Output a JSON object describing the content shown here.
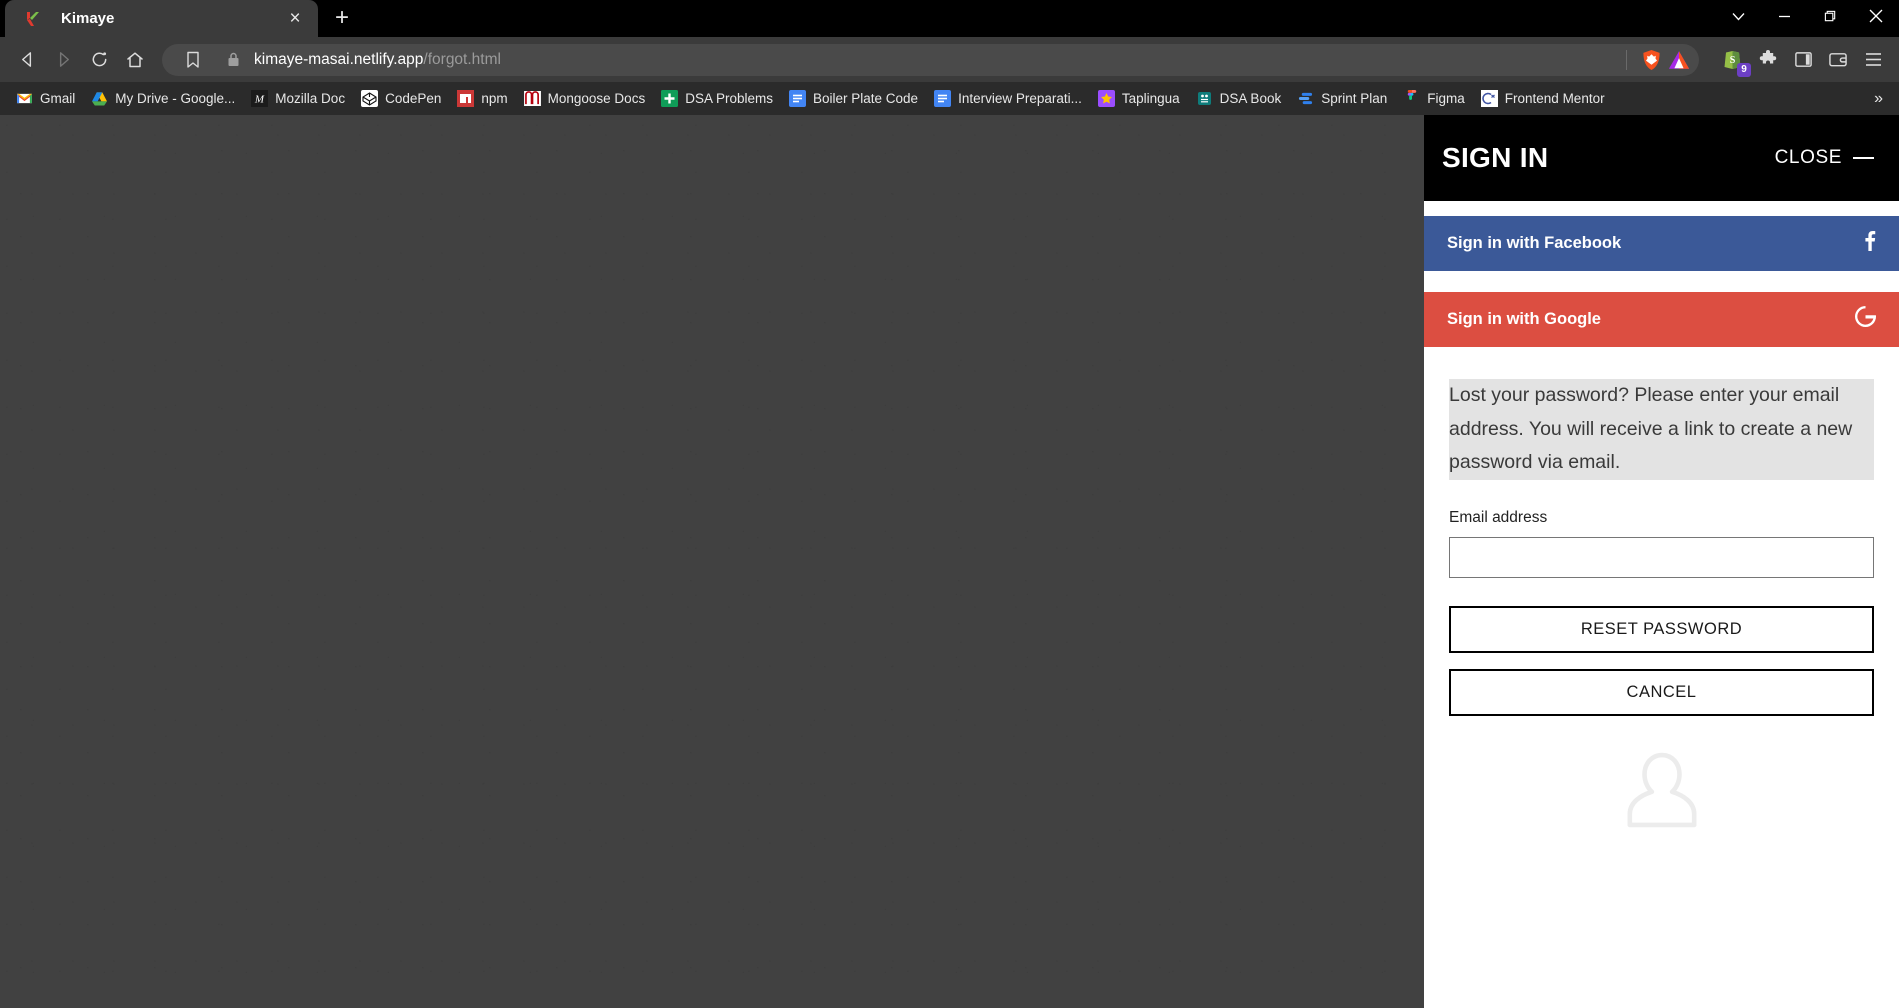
{
  "browser": {
    "tab": {
      "title": "Kimaye",
      "favicon": "kimaye-k-logo",
      "close_label": "×"
    },
    "new_tab_label": "+",
    "window_controls": [
      {
        "name": "tab-search",
        "glyph": "⌄"
      },
      {
        "name": "minimize",
        "glyph": "—"
      },
      {
        "name": "maximize",
        "glyph": "□"
      },
      {
        "name": "close",
        "glyph": "✕"
      }
    ],
    "nav": {
      "back_label": "◁",
      "forward_label": "▷",
      "reload_label": "↻",
      "home_label": "⌂",
      "bookmark_label": "☐"
    },
    "address": {
      "lock_icon": "lock-icon",
      "url_domain": "kimaye-masai.netlify.app",
      "url_path": "/forgot.html",
      "shield_icon": "brave-shield-icon",
      "rewards_icon": "brave-rewards-triangle-icon"
    },
    "toolbar_icons": [
      {
        "name": "shopify-extension-icon",
        "badge": "9"
      },
      {
        "name": "extensions-puzzle-icon",
        "badge": ""
      },
      {
        "name": "sidebar-panel-icon",
        "badge": ""
      },
      {
        "name": "wallet-icon",
        "badge": ""
      },
      {
        "name": "browser-menu-icon",
        "badge": ""
      }
    ],
    "bookmarks": {
      "items": [
        {
          "label": "Gmail",
          "icon": "gmail-icon"
        },
        {
          "label": "My Drive - Google...",
          "icon": "google-drive-icon"
        },
        {
          "label": "Mozilla Doc",
          "icon": "mdn-icon"
        },
        {
          "label": "CodePen",
          "icon": "codepen-icon"
        },
        {
          "label": "npm",
          "icon": "npm-icon"
        },
        {
          "label": "Mongoose Docs",
          "icon": "mongoose-icon"
        },
        {
          "label": "DSA Problems",
          "icon": "sheets-icon"
        },
        {
          "label": "Boiler Plate Code",
          "icon": "google-docs-icon"
        },
        {
          "label": "Interview Preparati...",
          "icon": "google-docs-icon"
        },
        {
          "label": "Taplingua",
          "icon": "star-icon"
        },
        {
          "label": "DSA Book",
          "icon": "robot-icon"
        },
        {
          "label": "Sprint Plan",
          "icon": "sprint-icon"
        },
        {
          "label": "Figma",
          "icon": "figma-icon"
        },
        {
          "label": "Frontend Mentor",
          "icon": "frontend-mentor-icon"
        }
      ],
      "overflow_label": "»"
    }
  },
  "panel": {
    "title": "SIGN IN",
    "close_label": "CLOSE",
    "social": [
      {
        "label": "Sign in with Facebook",
        "icon": "facebook-f-icon",
        "color": "#3b5998"
      },
      {
        "label": "Sign in with Google",
        "icon": "google-g-icon",
        "color": "#dc4e41"
      }
    ],
    "lost_password_text": "Lost your password? Please enter your email address. You will receive a link to create a new password via email.",
    "email_label": "Email address",
    "email_value": "",
    "email_placeholder": "",
    "reset_button": "RESET PASSWORD",
    "cancel_button": "CANCEL",
    "avatar_icon": "user-avatar-icon"
  },
  "colors": {
    "chrome_bg": "#3b3b3b",
    "bookmarks_bg": "#2b2b2b",
    "panel_header_bg": "#000000",
    "facebook_blue": "#3b5998",
    "google_red": "#dc4e41",
    "page_dim": "#414141"
  }
}
